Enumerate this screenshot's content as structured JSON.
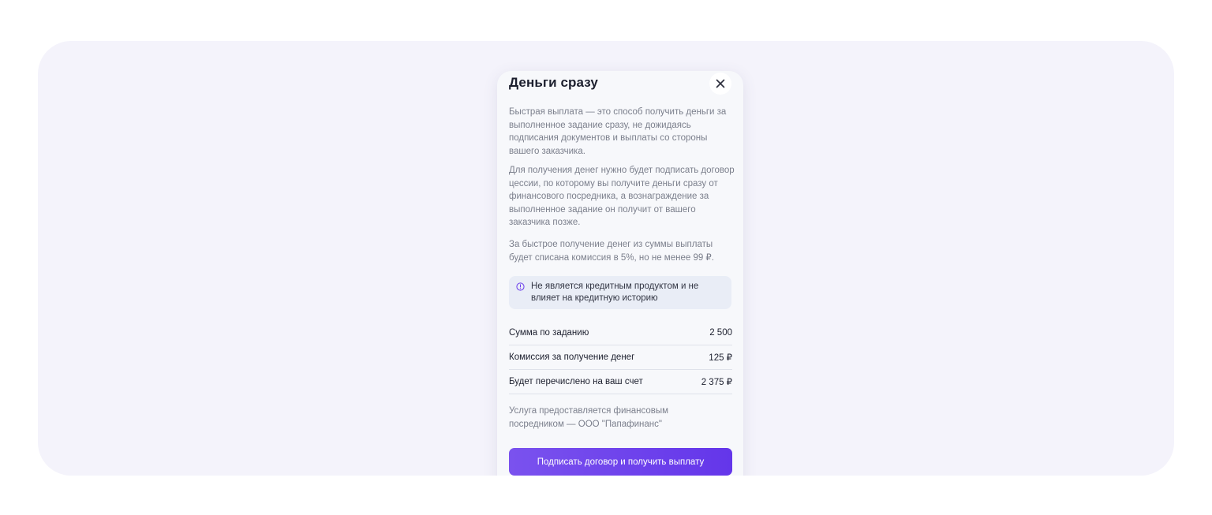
{
  "modal": {
    "title": "Деньги сразу",
    "paragraphs": [
      "Быстрая выплата — это способ получить деньги за выполненное задание сразу, не дожидаясь подписания документов и выплаты со стороны вашего заказчика.",
      "Для получения денег нужно будет подписать договор цессии, по которому вы получите деньги сразу от финансового посредника, а вознаграждение за выполненное задание он получит от вашего заказчика позже.",
      "За быстрое получение денег из суммы выплаты будет списана комиссия в 5%, но не менее 99 ₽."
    ],
    "notice": {
      "icon": "info-icon",
      "text": "Не является кредитным продуктом и не влияет на кредитную историю"
    },
    "summary": [
      {
        "label": "Сумма по заданию",
        "value": "2 500"
      },
      {
        "label": "Комиссия за получение денег",
        "value": "125 ₽"
      },
      {
        "label": "Будет перечислено на ваш счет",
        "value": "2 375 ₽"
      }
    ],
    "footer_note": "Услуга предоставляется финансовым посредником — ООО \"Папафинанс\"",
    "cta_label": "Подписать договор и получить выплату",
    "close_icon": "close-icon"
  },
  "colors": {
    "accent": "#6a3ceb",
    "backdrop": "#f4f3fb"
  }
}
